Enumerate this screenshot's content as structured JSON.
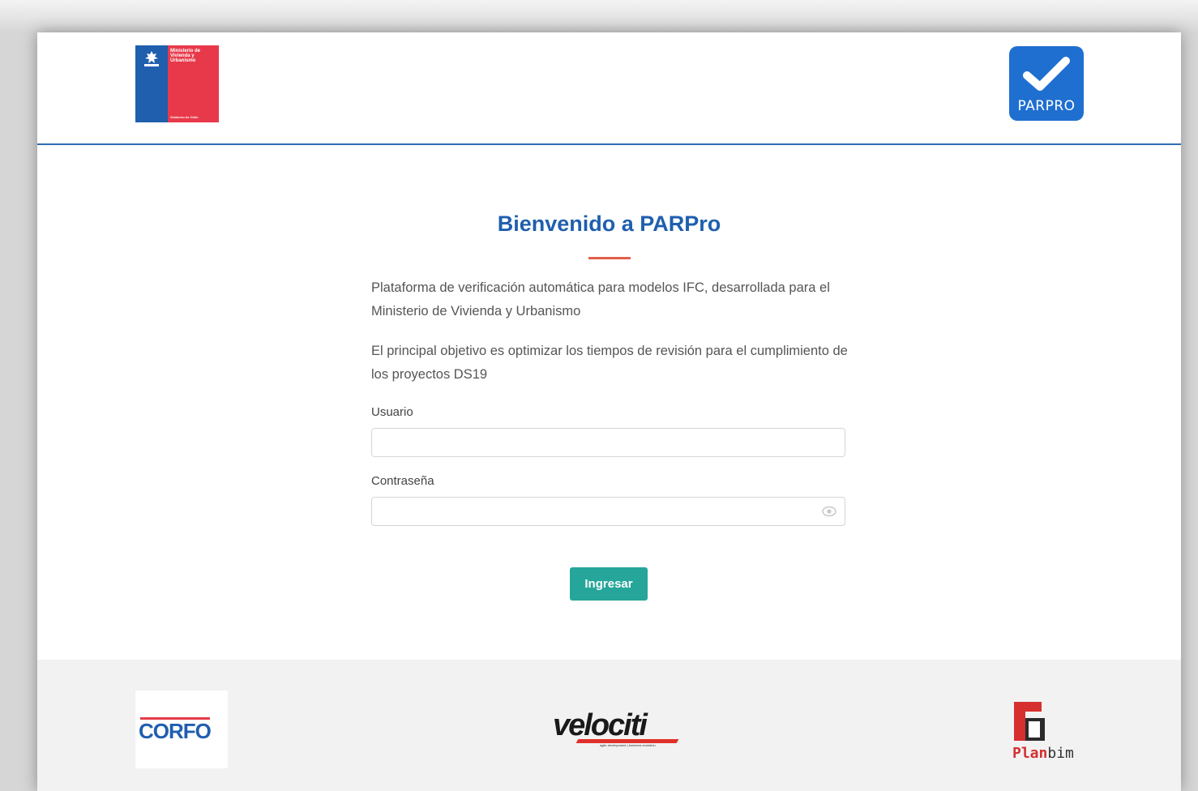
{
  "header": {
    "ministry_logo": {
      "text": "Ministerio de Vivienda y Urbanismo",
      "sub": "Gobierno de Chile",
      "colors": {
        "blue": "#1f5fae",
        "red": "#e8394a"
      }
    },
    "app_logo": {
      "label": "PARPRO",
      "icon": "check-icon",
      "color": "#1f6fd1"
    }
  },
  "main": {
    "title": "Bienvenido a PARPro",
    "description_1": "Plataforma de verificación automática para modelos IFC, desarrollada para el Ministerio de Vivienda y Urbanismo",
    "description_2": "El principal objetivo es optimizar los tiempos de revisión para el cumplimiento de los proyectos DS19",
    "form": {
      "user_label": "Usuario",
      "user_value": "",
      "password_label": "Contraseña",
      "password_value": "",
      "password_icon": "eye-icon",
      "submit_label": "Ingresar"
    },
    "colors": {
      "title": "#1f5fae",
      "accent": "#e0604a",
      "button": "#26a69a"
    }
  },
  "footer": {
    "logos": [
      {
        "name": "CORFO",
        "text": "CORFO"
      },
      {
        "name": "velociti",
        "text": "velociti",
        "sub": "agile development | business evolution"
      },
      {
        "name": "Planbim",
        "text_plan": "Plan",
        "text_bim": "bim"
      }
    ]
  }
}
